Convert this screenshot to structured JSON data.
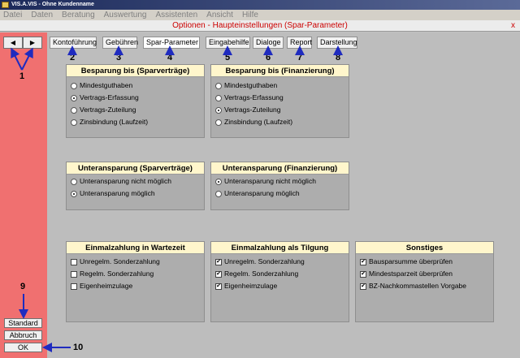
{
  "window": {
    "title": "VIS.A.VIS - Ohne Kundenname"
  },
  "menu": [
    "Datei",
    "Daten",
    "Beratung",
    "Auswertung",
    "Assistenten",
    "Ansicht",
    "Hilfe"
  ],
  "dialog": {
    "title": "Optionen - Haupteinstellungen    (Spar-Parameter)",
    "close": "x"
  },
  "nav": {
    "prev": "◀",
    "next": "▶"
  },
  "tabs": [
    "Kontoführung",
    "Gebühren",
    "Spar-Parameter",
    "Eingabehilfe",
    "Dialoge",
    "Report",
    "Darstellung"
  ],
  "callouts": [
    "1",
    "2",
    "3",
    "4",
    "5",
    "6",
    "7",
    "8",
    "9",
    "10"
  ],
  "panels": {
    "besparung_spar": {
      "title": "Besparung bis (Sparverträge)",
      "options": [
        "Mindestguthaben",
        "Vertrags-Erfassung",
        "Vertrags-Zuteilung",
        "Zinsbindung (Laufzeit)"
      ],
      "selected": 1
    },
    "besparung_fin": {
      "title": "Besparung bis (Finanzierung)",
      "options": [
        "Mindestguthaben",
        "Vertrags-Erfassung",
        "Vertrags-Zuteilung",
        "Zinsbindung (Laufzeit)"
      ],
      "selected": 2
    },
    "unter_spar": {
      "title": "Unteransparung (Sparverträge)",
      "options": [
        "Unteransparung nicht möglich",
        "Unteransparung möglich"
      ],
      "selected": 1
    },
    "unter_fin": {
      "title": "Unteransparung (Finanzierung)",
      "options": [
        "Unteransparung nicht möglich",
        "Unteransparung möglich"
      ],
      "selected": 0
    },
    "einmal_wartezeit": {
      "title": "Einmalzahlung in Wartezeit",
      "options": [
        "Unregelm. Sonderzahlung",
        "Regelm. Sonderzahlung",
        "Eigenheimzulage"
      ],
      "checked": [
        false,
        false,
        false
      ]
    },
    "einmal_tilgung": {
      "title": "Einmalzahlung als Tilgung",
      "options": [
        "Unregelm. Sonderzahlung",
        "Regelm. Sonderzahlung",
        "Eigenheimzulage"
      ],
      "checked": [
        true,
        true,
        true
      ]
    },
    "sonstiges": {
      "title": "Sonstiges",
      "options": [
        "Bausparsumme überprüfen",
        "Mindestsparzeit überprüfen",
        "BZ-Nachkommastellen Vorgabe"
      ],
      "checked": [
        true,
        true,
        true
      ]
    }
  },
  "buttons": {
    "standard": "Standard",
    "abbruch": "Abbruch",
    "ok": "OK"
  },
  "colors": {
    "sidebar": "#f07070",
    "panel_header": "#fff6cc",
    "arrow": "#1f2bbf",
    "dialog_title": "#cc0000"
  }
}
